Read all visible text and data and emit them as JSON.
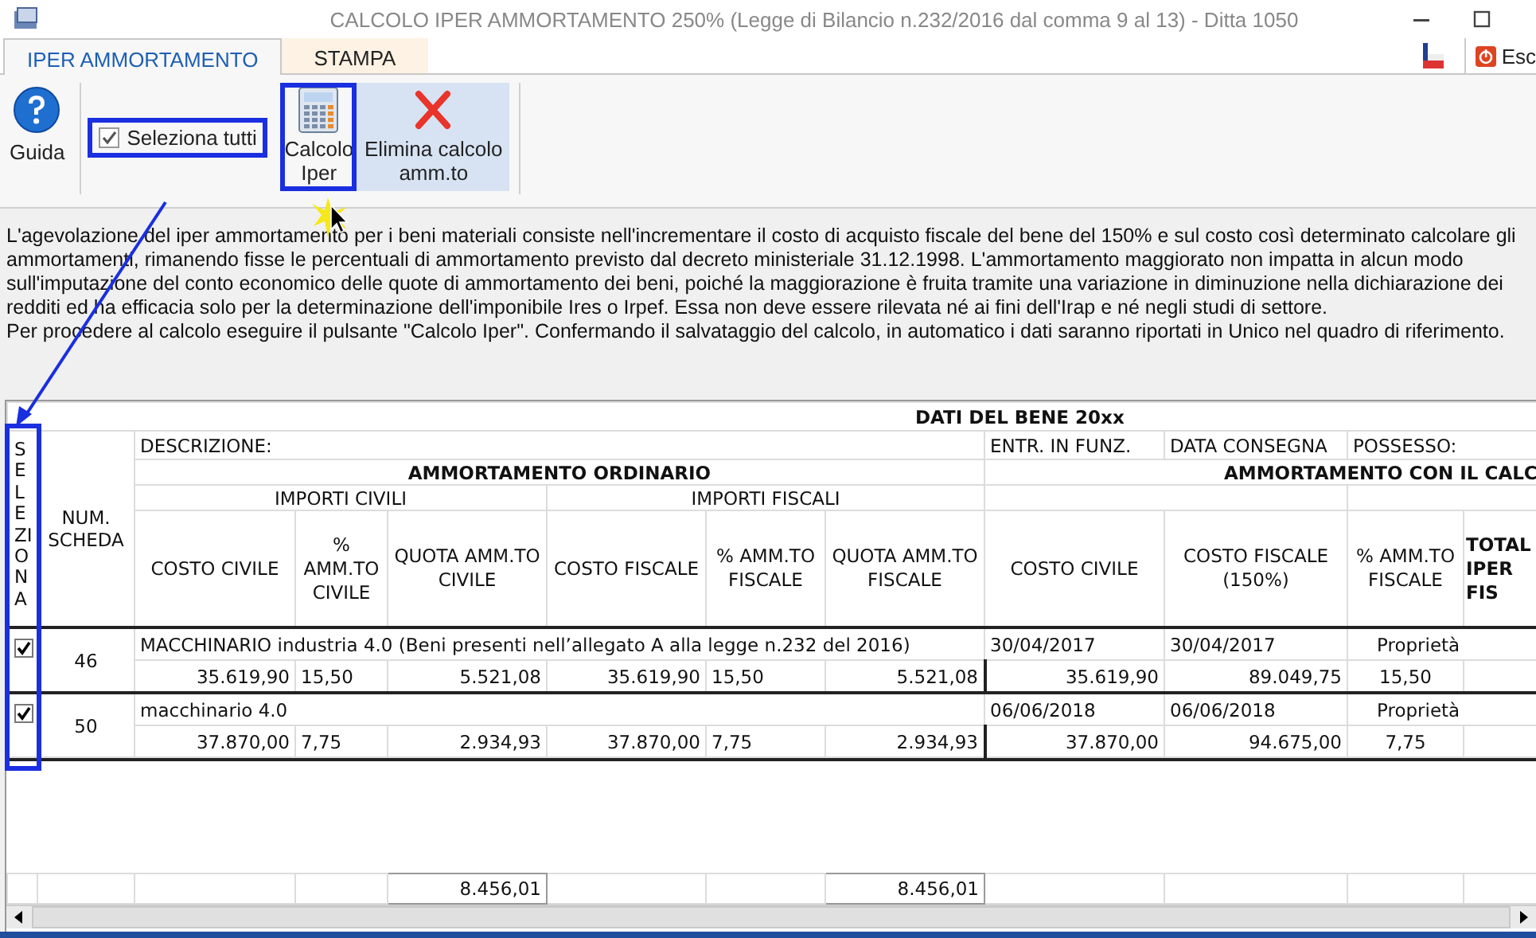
{
  "window": {
    "title": "CALCOLO IPER AMMORTAMENTO 250% (Legge di Bilancio n.232/2016 dal comma 9 al 13) - Ditta 1050"
  },
  "tabs": [
    {
      "label": "IPER AMMORTAMENTO",
      "selected": true
    },
    {
      "label": "STAMPA",
      "selected": false
    }
  ],
  "exit_button": {
    "label": "Esc"
  },
  "ribbon": {
    "help_button": {
      "label": "Guida"
    },
    "select_all": {
      "label": "Seleziona tutti",
      "checked": true
    },
    "buttons": [
      {
        "kind": "calculator",
        "label": "Calcolo Iper",
        "highlighted": false
      },
      {
        "kind": "delete",
        "label": "Elimina calcolo amm.to",
        "highlighted": true
      }
    ]
  },
  "description": [
    "L'agevolazione del iper ammortamento per i beni materiali consiste nell'incrementare il costo di acquisto fiscale del bene del 150% e sul costo così determinato calcolare gli ammortamenti, rimanendo fisse le percentuali di ammortamento previsto dal decreto ministeriale 31.12.1998. L'ammortamento maggiorato non impatta in alcun modo sull'imputazione del conto economico delle quote di ammortamento dei beni, poiché la maggiorazione è fruita tramite una variazione in diminuzione nella dichiarazione dei redditi ed ha efficacia solo per la determinazione dell'imponibile Ires o Irpef. Essa non deve essere rilevata né ai fini dell'Irap e né negli studi di settore.",
    "Per procedere al calcolo eseguire il pulsante \"Calcolo Iper\". Confermando il salvataggio del calcolo, in automatico i dati saranno riportati in Unico nel quadro di riferimento."
  ],
  "table": {
    "title": "DATI DEL BENE 20xx",
    "select_header": "SELEZIONA",
    "number_header": "NUM. SCHEDA",
    "description_header": "DESCRIZIONE:",
    "entry_header": "ENTR. IN FUNZ.",
    "delivery_header": "DATA CONSEGNA",
    "possession_header": "POSSESSO:",
    "group_headers": [
      "AMMORTAMENTO ORDINARIO",
      "AMMORTAMENTO CON IL CALC"
    ],
    "subgroup_headers": [
      "IMPORTI CIVILI",
      "IMPORTI FISCALI"
    ],
    "columns": [
      "COSTO CIVILE",
      "% AMM.TO CIVILE",
      "QUOTA AMM.TO CIVILE",
      "COSTO FISCALE",
      "% AMM.TO FISCALE",
      "QUOTA AMM.TO FISCALE",
      "COSTO CIVILE",
      "COSTO FISCALE (150%)",
      "% AMM.TO FISCALE",
      "TOTAL IPER FIS"
    ],
    "rows": [
      {
        "checked": true,
        "number": "46",
        "description": "MACCHINARIO industria 4.0 (Beni presenti nell’allegato A alla legge n.232 del 2016)",
        "entry_date": "30/04/2017",
        "delivery_date": "30/04/2017",
        "possession": "Proprietà",
        "values": [
          "35.619,90",
          "15,50",
          "5.521,08",
          "35.619,90",
          "15,50",
          "5.521,08",
          "35.619,90",
          "89.049,75",
          "15,50"
        ]
      },
      {
        "checked": true,
        "number": "50",
        "description": "macchinario 4.0",
        "entry_date": "06/06/2018",
        "delivery_date": "06/06/2018",
        "possession": "Proprietà",
        "values": [
          "37.870,00",
          "7,75",
          "2.934,93",
          "37.870,00",
          "7,75",
          "2.934,93",
          "37.870,00",
          "94.675,00",
          "7,75"
        ]
      }
    ],
    "totals": {
      "civil_quota": "8.456,01",
      "fiscal_quota": "8.456,01"
    }
  }
}
